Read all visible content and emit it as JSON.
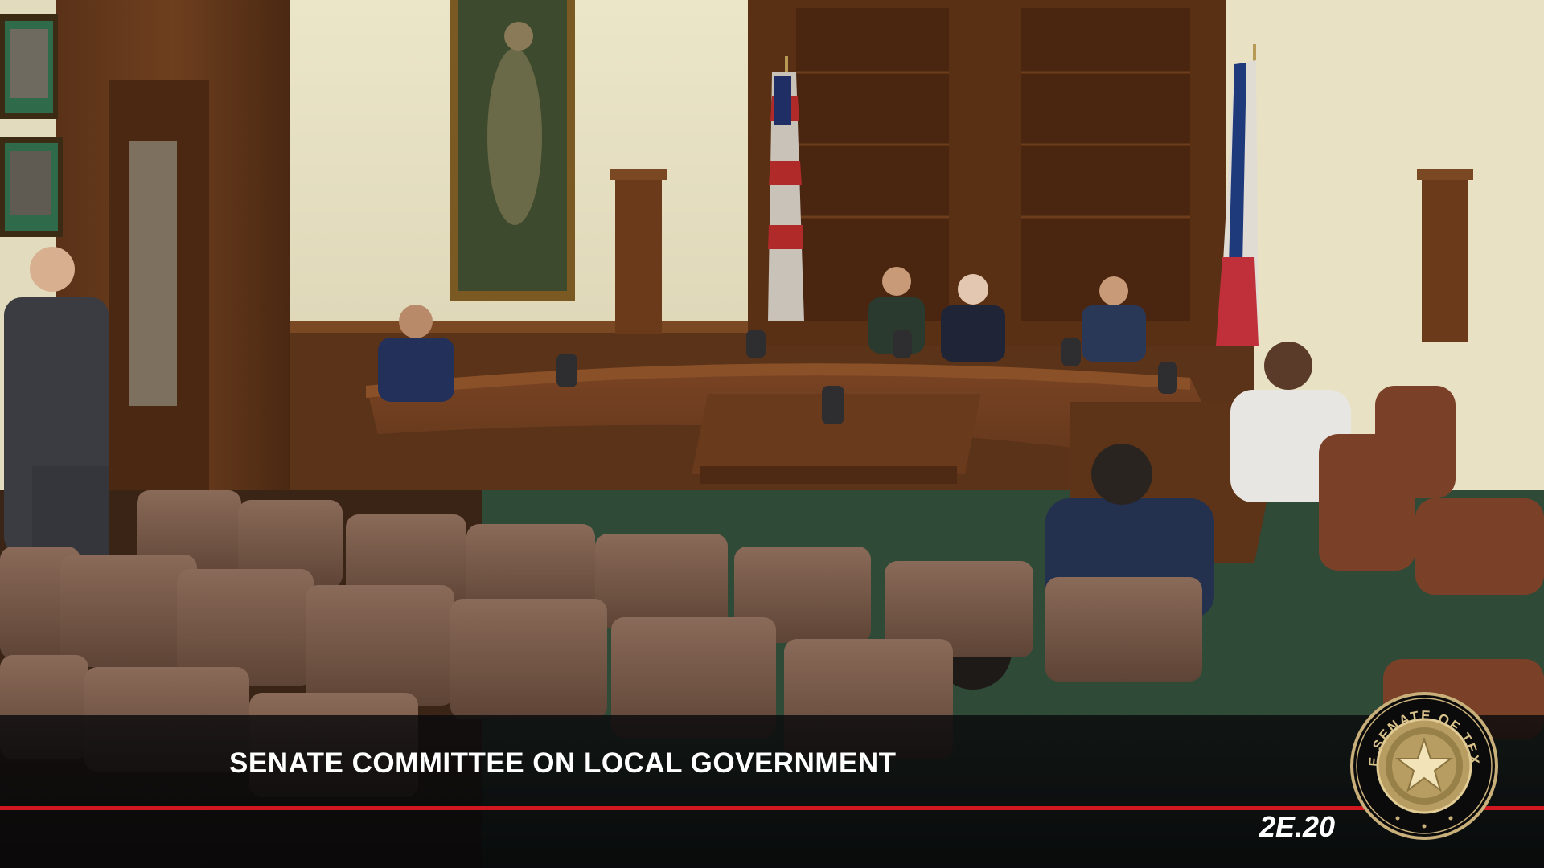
{
  "broadcast": {
    "title": "SENATE COMMITTEE ON LOCAL GOVERNMENT",
    "room_code": "2E.20"
  },
  "seal": {
    "text": "THE SENATE OF TEXAS",
    "icon": "texas-star-seal-icon"
  },
  "colors": {
    "accent_red": "#d0161e",
    "banner_dark": "#0a0a0c",
    "seal_gold": "#c9b07a"
  }
}
